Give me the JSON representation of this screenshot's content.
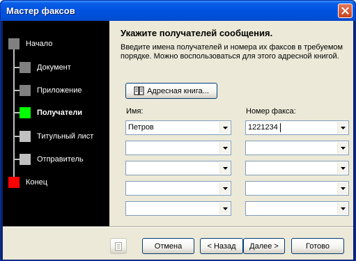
{
  "window": {
    "title": "Мастер факсов"
  },
  "steps": [
    {
      "label": "Начало",
      "color": "#808080",
      "level": 0,
      "active": false
    },
    {
      "label": "Документ",
      "color": "#808080",
      "level": 1,
      "active": false
    },
    {
      "label": "Приложение",
      "color": "#808080",
      "level": 1,
      "active": false
    },
    {
      "label": "Получатели",
      "color": "#00ff00",
      "level": 1,
      "active": true
    },
    {
      "label": "Титульный лист",
      "color": "#c0c0c0",
      "level": 1,
      "active": false
    },
    {
      "label": "Отправитель",
      "color": "#c0c0c0",
      "level": 1,
      "active": false
    },
    {
      "label": "Конец",
      "color": "#ff0000",
      "level": 0,
      "active": false
    }
  ],
  "page": {
    "heading": "Укажите получателей сообщения.",
    "description": "Введите имена получателей и номера их факсов в требуемом порядке. Можно воспользоваться для этого адресной книгой.",
    "address_book_label": "Адресная книга...",
    "name_column_label": "Имя:",
    "fax_column_label": "Номер факса:",
    "recipients": [
      {
        "name": "Петров",
        "fax": "1221234"
      },
      {
        "name": "",
        "fax": ""
      },
      {
        "name": "",
        "fax": ""
      },
      {
        "name": "",
        "fax": ""
      },
      {
        "name": "",
        "fax": ""
      }
    ]
  },
  "buttons": {
    "cancel": "Отмена",
    "back": "< Назад",
    "next": "Далее >",
    "finish": "Готово"
  }
}
